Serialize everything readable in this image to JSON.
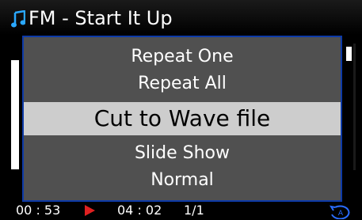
{
  "title": "FM - Start It Up",
  "menu": {
    "items": [
      {
        "label": "Repeat One"
      },
      {
        "label": "Repeat All"
      },
      {
        "label": "Cut to Wave file"
      },
      {
        "label": "Slide Show"
      },
      {
        "label": "Normal"
      }
    ],
    "selected": "Cut to Wave file"
  },
  "status": {
    "elapsed": "00 : 53",
    "total": "04 : 02",
    "track": "1/1",
    "repeat_mode_badge": "A"
  },
  "icons": {
    "title": "music-note-icon",
    "play": "play-icon",
    "repeat": "repeat-all-icon"
  },
  "colors": {
    "accent": "#0d3aa8",
    "play": "#e02020",
    "selected_bg": "#cdcdcd",
    "popup_bg": "#505050"
  }
}
